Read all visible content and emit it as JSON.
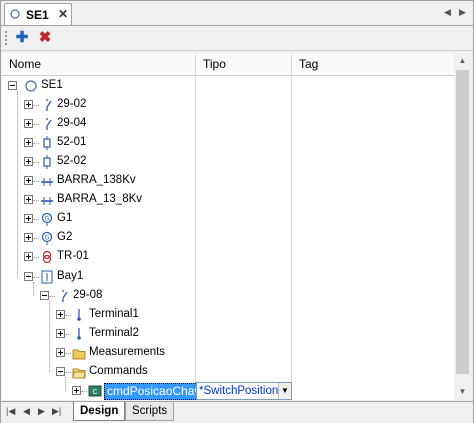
{
  "document_tab": {
    "label": "SE1",
    "close": "✕"
  },
  "tab_scroll": {
    "left": "◀",
    "right": "▶"
  },
  "toolbar": {
    "add": "✚",
    "delete": "✖"
  },
  "columns": [
    "Nome",
    "Tipo",
    "Tag"
  ],
  "tree": [
    {
      "label": "SE1",
      "icon": "substation-icon",
      "depth": 0,
      "expander": "minus"
    },
    {
      "label": "29-02",
      "icon": "disconnector-icon",
      "depth": 1,
      "expander": "plus"
    },
    {
      "label": "29-04",
      "icon": "disconnector-icon",
      "depth": 1,
      "expander": "plus"
    },
    {
      "label": "52-01",
      "icon": "breaker-icon",
      "depth": 1,
      "expander": "plus"
    },
    {
      "label": "52-02",
      "icon": "breaker-icon",
      "depth": 1,
      "expander": "plus"
    },
    {
      "label": "BARRA_138Kv",
      "icon": "busbar-icon",
      "depth": 1,
      "expander": "plus"
    },
    {
      "label": "BARRA_13_8Kv",
      "icon": "busbar-icon",
      "depth": 1,
      "expander": "plus"
    },
    {
      "label": "G1",
      "icon": "generator-icon",
      "depth": 1,
      "expander": "plus"
    },
    {
      "label": "G2",
      "icon": "generator-icon",
      "depth": 1,
      "expander": "plus"
    },
    {
      "label": "TR-01",
      "icon": "transformer-icon",
      "depth": 1,
      "expander": "plus"
    },
    {
      "label": "Bay1",
      "icon": "bay-icon",
      "depth": 1,
      "expander": "minus"
    },
    {
      "label": "29-08",
      "icon": "disconnector-icon",
      "depth": 2,
      "expander": "minus"
    },
    {
      "label": "Terminal1",
      "icon": "terminal-icon",
      "depth": 3,
      "expander": "plus"
    },
    {
      "label": "Terminal2",
      "icon": "terminal-icon",
      "depth": 3,
      "expander": "plus"
    },
    {
      "label": "Measurements",
      "icon": "folder-icon",
      "depth": 3,
      "expander": "plus"
    },
    {
      "label": "Commands",
      "icon": "folder-open-icon",
      "depth": 3,
      "expander": "minus"
    },
    {
      "label": "cmdPosicaoChave",
      "icon": "command-icon",
      "depth": 4,
      "expander": "plus",
      "selected": true,
      "tipo": "*SwitchPosition"
    }
  ],
  "scrollbar": {
    "up": "▲",
    "down": "▼"
  },
  "sheet_nav": {
    "first": "|◀",
    "prev": "◀",
    "next": "▶",
    "last": "▶|"
  },
  "sheet_tabs": [
    "Design",
    "Scripts"
  ],
  "colors": {
    "selection": "#3399ff",
    "accent_blue": "#1f5fbf",
    "delete_red": "#c0282d"
  }
}
